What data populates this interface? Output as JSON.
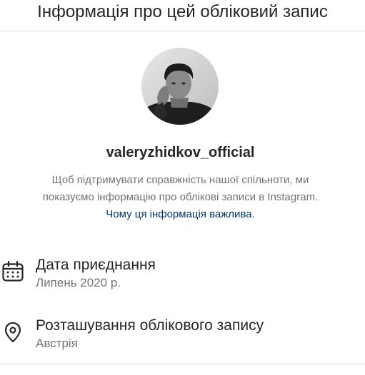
{
  "header": {
    "title": "Інформація про цей обліковий запис"
  },
  "profile": {
    "avatar_icon": "profile-photo",
    "username": "valeryzhidkov_official",
    "description_line1": "Щоб підтримувати справжність нашої спільноти, ми",
    "description_line2": "показуємо інформацію про облікові записи в Instagram.",
    "why_link": "Чому ця інформація важлива."
  },
  "details": {
    "join_date": {
      "icon": "calendar-icon",
      "title": "Дата приєднання",
      "value": "Липень 2020 р."
    },
    "location": {
      "icon": "location-pin-icon",
      "title": "Розташування облікового запису",
      "value": "Австрія"
    }
  },
  "colors": {
    "text_primary": "#262626",
    "text_secondary": "#737373",
    "link": "#00376b",
    "divider": "#dbdbdb"
  }
}
